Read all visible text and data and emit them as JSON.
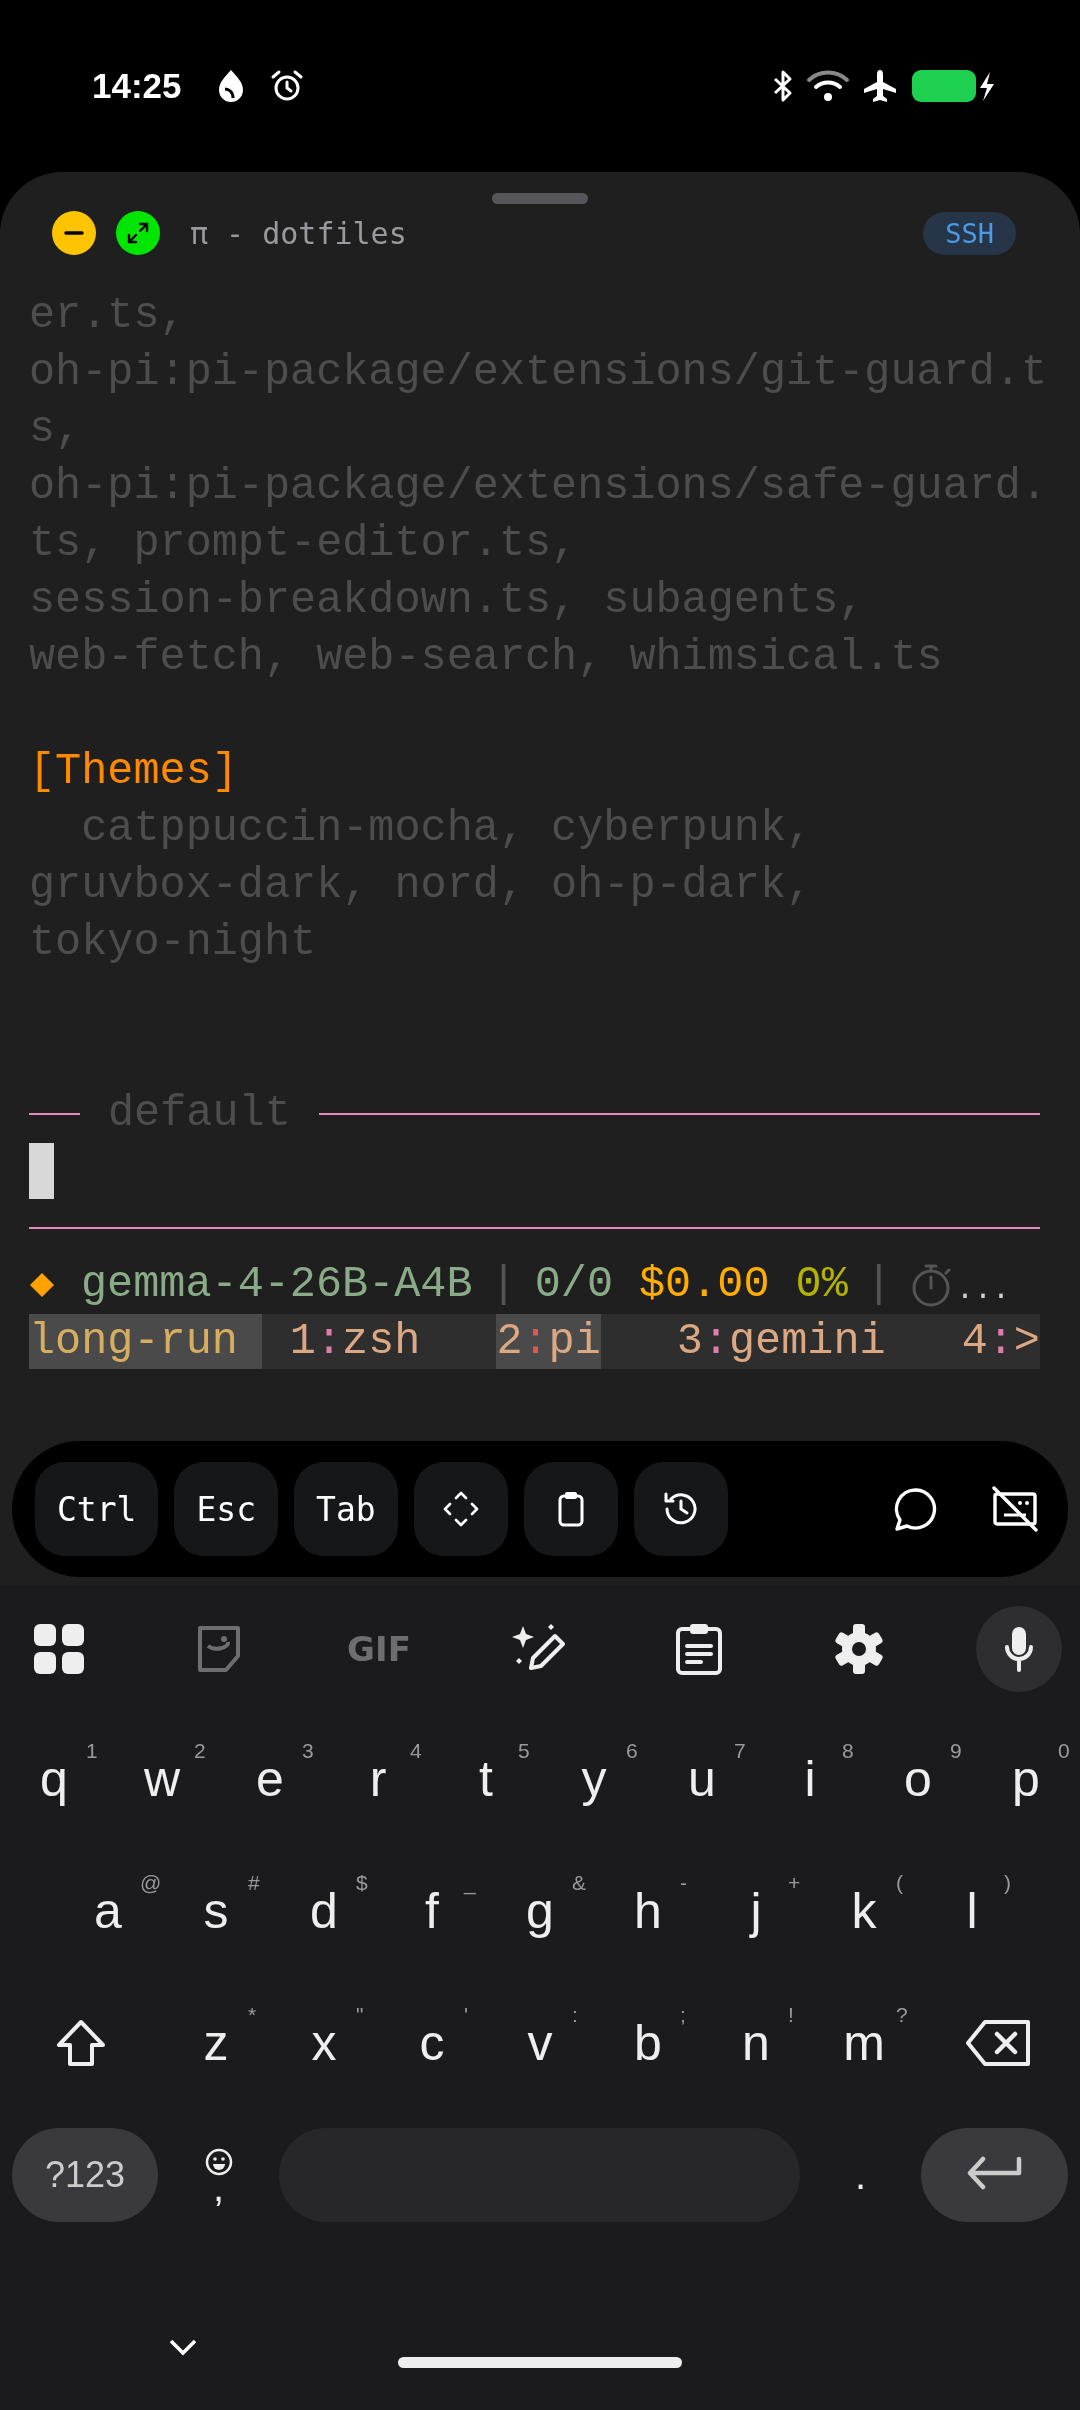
{
  "status_bar": {
    "time": "14:25"
  },
  "terminal": {
    "title": "π - dotfiles",
    "badge": "SSH",
    "output": [
      {
        "kind": "text",
        "lines": [
          "er.ts,",
          "oh-pi:pi-package/extensions/git-guard.t",
          "s,",
          "oh-pi:pi-package/extensions/safe-guard.",
          "ts, prompt-editor.ts,",
          "session-breakdown.ts, subagents,",
          "web-fetch, web-search, whimsical.ts"
        ]
      },
      {
        "kind": "heading",
        "lines": [
          "[Themes]"
        ]
      },
      {
        "kind": "text",
        "lines": [
          "  catppuccin-mocha, cyberpunk,",
          "gruvbox-dark, nord, oh-p-dark,",
          "tokyo-night"
        ]
      }
    ],
    "editor": {
      "label": "default"
    },
    "footer": {
      "model": "gemma-4-26B-A4B",
      "separators": [
        "|",
        "|"
      ],
      "tokens": "0/0",
      "cost": "$0.00",
      "context": "0%",
      "overflow": "..."
    },
    "tmux": {
      "session": "long-run",
      "windows": [
        {
          "number": "1",
          "separator": ":",
          "name": "zsh",
          "selected": false
        },
        {
          "number": "2",
          "separator": ":",
          "name": "pi",
          "selected": true
        },
        {
          "number": "3",
          "separator": ":",
          "name": "gemini",
          "selected": false
        },
        {
          "number": "4",
          "separator": ":",
          "name": ">",
          "selected": false
        }
      ]
    }
  },
  "toolbar": {
    "keys": [
      "Ctrl",
      "Esc",
      "Tab"
    ]
  },
  "keyboard": {
    "gif": "GIF",
    "rows": [
      [
        {
          "key": "q",
          "hint": "1"
        },
        {
          "key": "w",
          "hint": "2"
        },
        {
          "key": "e",
          "hint": "3"
        },
        {
          "key": "r",
          "hint": "4"
        },
        {
          "key": "t",
          "hint": "5"
        },
        {
          "key": "y",
          "hint": "6"
        },
        {
          "key": "u",
          "hint": "7"
        },
        {
          "key": "i",
          "hint": "8"
        },
        {
          "key": "o",
          "hint": "9"
        },
        {
          "key": "p",
          "hint": "0"
        }
      ],
      [
        {
          "key": "a",
          "hint": "@"
        },
        {
          "key": "s",
          "hint": "#"
        },
        {
          "key": "d",
          "hint": "$"
        },
        {
          "key": "f",
          "hint": "_"
        },
        {
          "key": "g",
          "hint": "&"
        },
        {
          "key": "h",
          "hint": "-"
        },
        {
          "key": "j",
          "hint": "+"
        },
        {
          "key": "k",
          "hint": "("
        },
        {
          "key": "l",
          "hint": ")"
        }
      ],
      [
        {
          "key": "z",
          "hint": "*"
        },
        {
          "key": "x",
          "hint": "\""
        },
        {
          "key": "c",
          "hint": "'"
        },
        {
          "key": "v",
          "hint": ":"
        },
        {
          "key": "b",
          "hint": ";"
        },
        {
          "key": "n",
          "hint": "!"
        },
        {
          "key": "m",
          "hint": "?"
        }
      ]
    ],
    "bottom": {
      "symbols": "?123",
      "comma": ",",
      "period": "."
    }
  }
}
